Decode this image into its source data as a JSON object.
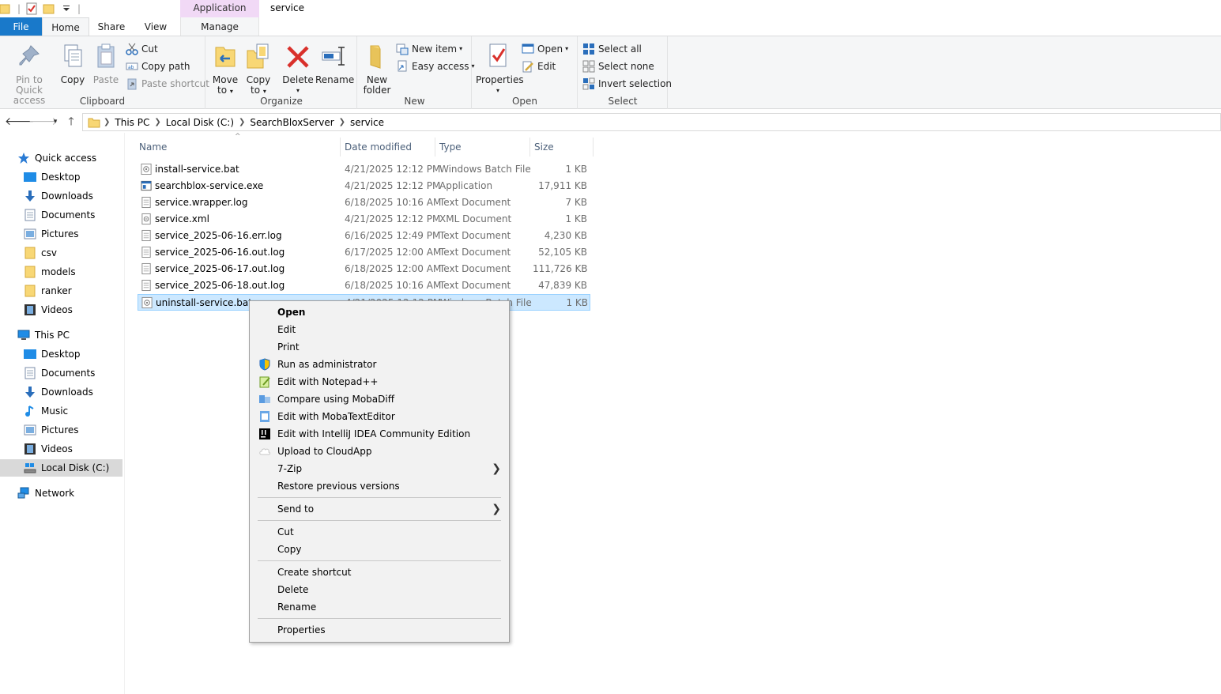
{
  "window": {
    "title": "service",
    "contextual_tab_group": "Application Tools"
  },
  "ribbon_tabs": {
    "file": "File",
    "home": "Home",
    "share": "Share",
    "view": "View",
    "manage": "Manage"
  },
  "ribbon": {
    "clipboard": {
      "label": "Clipboard",
      "pin_line1": "Pin to Quick",
      "pin_line2": "access",
      "copy": "Copy",
      "paste": "Paste",
      "cut": "Cut",
      "copy_path": "Copy path",
      "paste_shortcut": "Paste shortcut"
    },
    "organize": {
      "label": "Organize",
      "move_line1": "Move",
      "move_line2": "to",
      "copy_line1": "Copy",
      "copy_line2": "to",
      "delete": "Delete",
      "rename": "Rename"
    },
    "new": {
      "label": "New",
      "new_folder_line1": "New",
      "new_folder_line2": "folder",
      "new_item": "New item",
      "easy_access": "Easy access"
    },
    "open": {
      "label": "Open",
      "properties": "Properties",
      "open": "Open",
      "edit": "Edit"
    },
    "select": {
      "label": "Select",
      "select_all": "Select all",
      "select_none": "Select none",
      "invert_selection": "Invert selection"
    }
  },
  "breadcrumb": [
    "This PC",
    "Local Disk (C:)",
    "SearchBloxServer",
    "service"
  ],
  "nav_pane": {
    "quick_access": "Quick access",
    "quick_items": [
      {
        "label": "Desktop",
        "icon": "desktop-icon",
        "pinned": true
      },
      {
        "label": "Downloads",
        "icon": "downloads-icon",
        "pinned": true
      },
      {
        "label": "Documents",
        "icon": "documents-icon",
        "pinned": true
      },
      {
        "label": "Pictures",
        "icon": "pictures-icon",
        "pinned": true
      },
      {
        "label": "csv",
        "icon": "folder-icon",
        "pinned": false
      },
      {
        "label": "models",
        "icon": "folder-icon",
        "pinned": false
      },
      {
        "label": "ranker",
        "icon": "folder-icon",
        "pinned": false
      },
      {
        "label": "Videos",
        "icon": "videos-icon",
        "pinned": false
      }
    ],
    "this_pc": "This PC",
    "pc_items": [
      {
        "label": "Desktop",
        "icon": "desktop-icon"
      },
      {
        "label": "Documents",
        "icon": "documents-icon"
      },
      {
        "label": "Downloads",
        "icon": "downloads-icon"
      },
      {
        "label": "Music",
        "icon": "music-icon"
      },
      {
        "label": "Pictures",
        "icon": "pictures-icon"
      },
      {
        "label": "Videos",
        "icon": "videos-icon"
      },
      {
        "label": "Local Disk (C:)",
        "icon": "local-disk-icon"
      }
    ],
    "network": "Network"
  },
  "columns": {
    "name": "Name",
    "date": "Date modified",
    "type": "Type",
    "size": "Size"
  },
  "files": [
    {
      "name": "install-service.bat",
      "date": "4/21/2025 12:12 PM",
      "type": "Windows Batch File",
      "size": "1 KB",
      "icon": "batch-file-icon"
    },
    {
      "name": "searchblox-service.exe",
      "date": "4/21/2025 12:12 PM",
      "type": "Application",
      "size": "17,911 KB",
      "icon": "application-icon"
    },
    {
      "name": "service.wrapper.log",
      "date": "6/18/2025 10:16 AM",
      "type": "Text Document",
      "size": "7 KB",
      "icon": "text-file-icon"
    },
    {
      "name": "service.xml",
      "date": "4/21/2025 12:12 PM",
      "type": "XML Document",
      "size": "1 KB",
      "icon": "xml-file-icon"
    },
    {
      "name": "service_2025-06-16.err.log",
      "date": "6/16/2025 12:49 PM",
      "type": "Text Document",
      "size": "4,230 KB",
      "icon": "text-file-icon"
    },
    {
      "name": "service_2025-06-16.out.log",
      "date": "6/17/2025 12:00 AM",
      "type": "Text Document",
      "size": "52,105 KB",
      "icon": "text-file-icon"
    },
    {
      "name": "service_2025-06-17.out.log",
      "date": "6/18/2025 12:00 AM",
      "type": "Text Document",
      "size": "111,726 KB",
      "icon": "text-file-icon"
    },
    {
      "name": "service_2025-06-18.out.log",
      "date": "6/18/2025 10:16 AM",
      "type": "Text Document",
      "size": "47,839 KB",
      "icon": "text-file-icon"
    },
    {
      "name": "uninstall-service.bat",
      "date": "4/21/2025 12:12 PM",
      "type": "Windows Batch File",
      "size": "1 KB",
      "icon": "batch-file-icon",
      "selected": true
    }
  ],
  "context_menu": {
    "open": "Open",
    "edit": "Edit",
    "print": "Print",
    "run_as_admin": "Run as administrator",
    "notepadpp": "Edit with Notepad++",
    "mobadiff": "Compare using MobaDiff",
    "mobatext": "Edit with MobaTextEditor",
    "intellij": "Edit with IntelliJ IDEA Community Edition",
    "cloudapp": "Upload to CloudApp",
    "sevenzip": "7-Zip",
    "restore": "Restore previous versions",
    "send_to": "Send to",
    "cut": "Cut",
    "copy": "Copy",
    "create_shortcut": "Create shortcut",
    "delete": "Delete",
    "rename": "Rename",
    "properties": "Properties"
  }
}
